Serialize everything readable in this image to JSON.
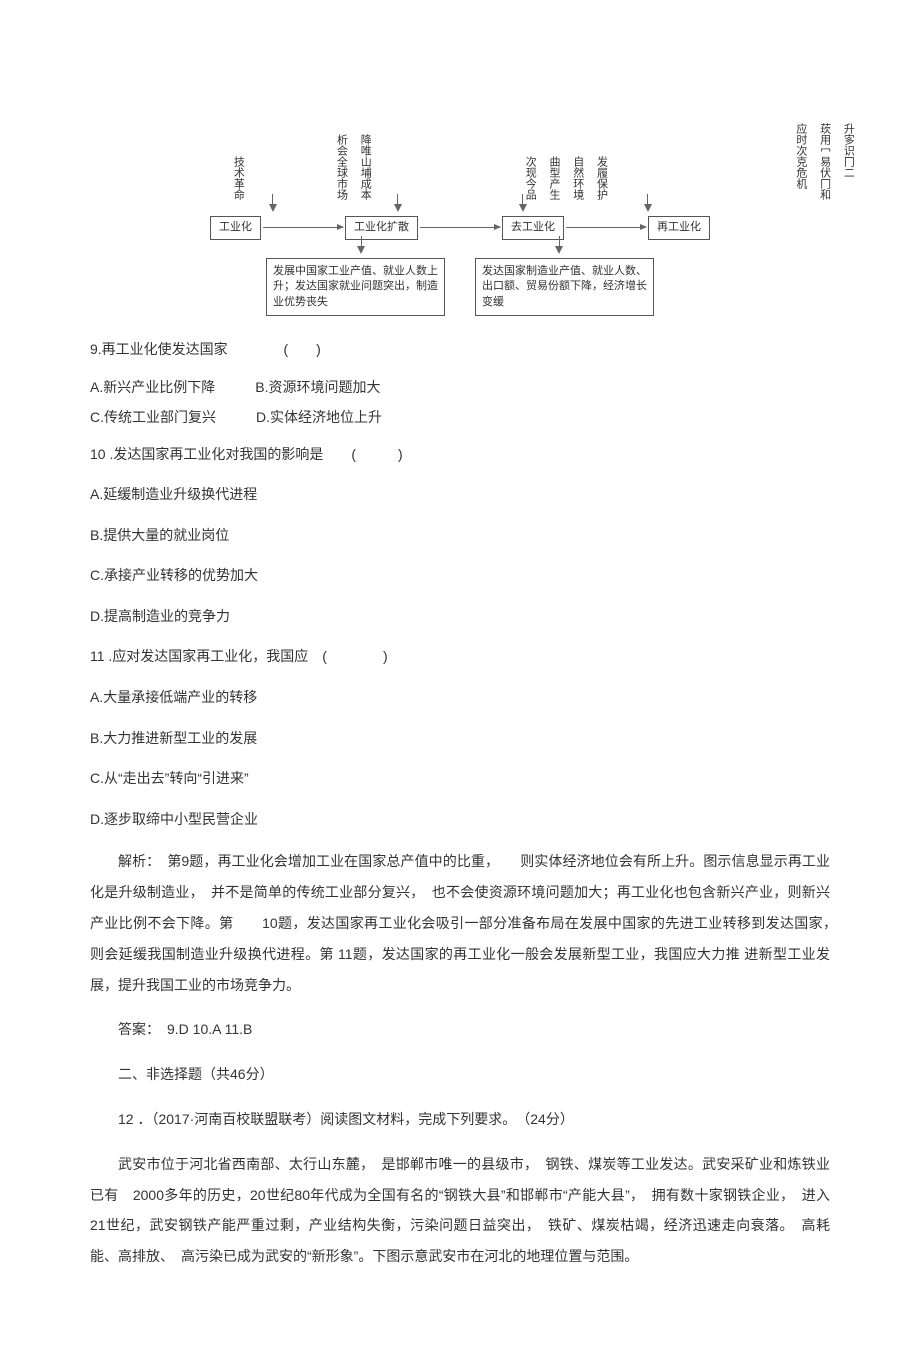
{
  "diagram": {
    "labels": {
      "col1": [
        "技术革命"
      ],
      "col2": [
        "析会全球市场",
        "降唯山埔成本"
      ],
      "col3": [
        "次现今品",
        "曲型产生",
        "自然环境",
        "发履保护"
      ],
      "col4": [
        "应时次克危机",
        "莰用冖易伏冂和",
        "升㝖识冂二"
      ]
    },
    "stages": [
      "工业化",
      "工业化扩散",
      "去工业化",
      "再工业化"
    ],
    "results": {
      "left": "发展中国家工业产值、就业人数上升；发达国家就业问题突出，制造业优势丧失",
      "right": "发达国家制造业产值、就业人数、出口额、贸易份额下降，经济增长变缓"
    }
  },
  "q9": {
    "stem": "9.再工业化使发达国家",
    "paren": "(　　)",
    "A": "A.新兴产业比例下降",
    "B": "B.资源环境问题加大",
    "C": "C.传统工业部门复兴",
    "D": "D.实体经济地位上升"
  },
  "q10": {
    "stem": "10 .发达国家再工业化对我国的影响是　　(　　　)",
    "A": "A.延缓制造业升级换代进程",
    "B": "B.提供大量的就业岗位",
    "C": "C.承接产业转移的优势加大",
    "D": "D.提高制造业的竞争力"
  },
  "q11": {
    "stem": "11 .应对发达国家再工业化，我国应　(　　　　)",
    "A": "A.大量承接低端产业的转移",
    "B": "B.大力推进新型工业的发展",
    "C": "C.从“走出去”转向“引进来”",
    "D": "D.逐步取缔中小型民营企业"
  },
  "explain": "解析：　第9题，再工业化会增加工业在国家总产值中的比重，　　则实体经济地位会有所上升。图示信息显示再工业化是升级制造业，　并不是简单的传统工业部分复兴，　也不会使资源环境问题加大；再工业化也包含新兴产业，则新兴产业比例不会下降。第　　10题，发达国家再工业化会吸引一部分准备布局在发展中国家的先进工业转移到发达国家，　　则会延缓我国制造业升级换代进程。第 11题，发达国家的再工业化一般会发展新型工业，我国应大力推 进新型工业发展，提升我国工业的市场竞争力。",
  "answers": "答案：　9.D 10.A 11.B",
  "section2": "二、非选择题（共46分）",
  "q12_head": "12 ．（2017·河南百校联盟联考）阅读图文材料，完成下列要求。　（24分）",
  "q12_body": "武安市位于河北省西南部、太行山东麓，　是邯郸市唯一的县级市，　钢铁、煤炭等工业发达。武安采矿业和炼铁业已有　2000多年的历史，20世纪80年代成为全国有名的“钢铁大县”和邯郸市“产能大县”，　拥有数十家钢铁企业，　进入21世纪，武安钢铁产能严重过剩，产业结构失衡，污染问题日益突出，　铁矿、煤炭枯竭，经济迅速走向衰落。　高耗能、高排放、　高污染已成为武安的“新形象”。下图示意武安市在河北的地理位置与范围。"
}
